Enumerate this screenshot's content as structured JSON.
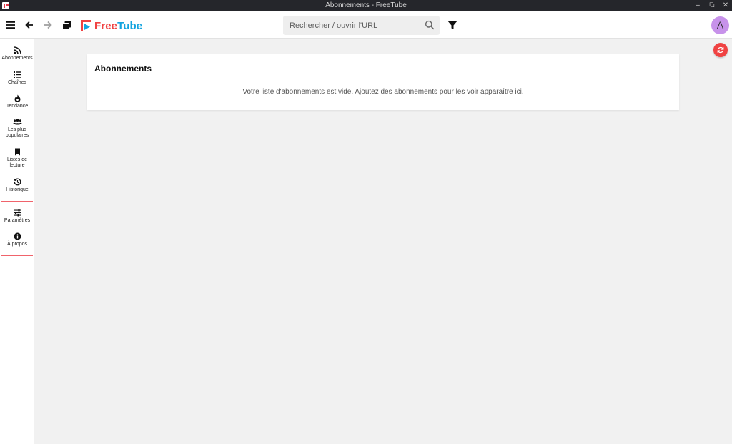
{
  "window": {
    "title": "Abonnements - FreeTube",
    "controls": [
      "minimize-icon",
      "restore-icon",
      "close-icon"
    ]
  },
  "topnav": {
    "logo": {
      "part1": "Free",
      "part2": "Tube"
    },
    "search": {
      "placeholder": "Rechercher / ouvrir l'URL",
      "value": ""
    },
    "avatar_letter": "A"
  },
  "sidebar": {
    "items": [
      {
        "label": "Abonnements",
        "icon": "rss-icon"
      },
      {
        "label": "Chaînes",
        "icon": "list-icon"
      },
      {
        "label": "Tendance",
        "icon": "fire-icon"
      },
      {
        "label": "Les plus populaires",
        "icon": "users-icon"
      },
      {
        "label": "Listes de lecture",
        "icon": "bookmark-icon"
      },
      {
        "label": "Historique",
        "icon": "history-icon"
      },
      {
        "label": "Paramètres",
        "icon": "sliders-icon"
      },
      {
        "label": "À propos",
        "icon": "info-icon"
      }
    ]
  },
  "main": {
    "title": "Abonnements",
    "empty_message": "Votre liste d'abonnements est vide. Ajoutez des abonnements pour les voir apparaître ici."
  },
  "colors": {
    "accent": "#f04242",
    "logo_free": "#f04242",
    "logo_tube": "#14a4df",
    "avatar": "#c792ea",
    "divider": "#f0636b"
  }
}
